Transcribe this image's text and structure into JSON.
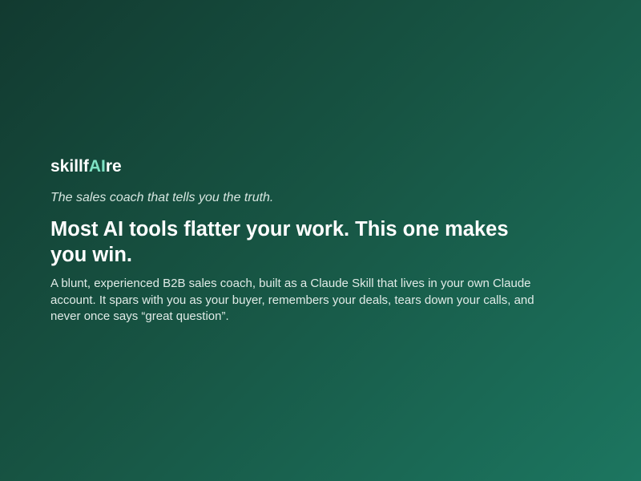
{
  "brand": {
    "logo_part_1": "skillf",
    "logo_part_2": "AI",
    "logo_part_3": "re",
    "accent_color": "#7ee2c4"
  },
  "hero": {
    "tagline": "The sales coach that tells you the truth.",
    "headline": "Most AI tools flatter your work. This one makes you win.",
    "description": "A blunt, experienced B2B sales coach, built as a Claude Skill that lives in your own Claude account. It spars with you as your buyer, remembers your deals, tears down your calls, and never once says “great question”."
  },
  "colors": {
    "background_start": "#123a30",
    "background_end": "#1c7660",
    "text_primary": "#ffffff",
    "text_secondary": "#e0ebe7"
  }
}
